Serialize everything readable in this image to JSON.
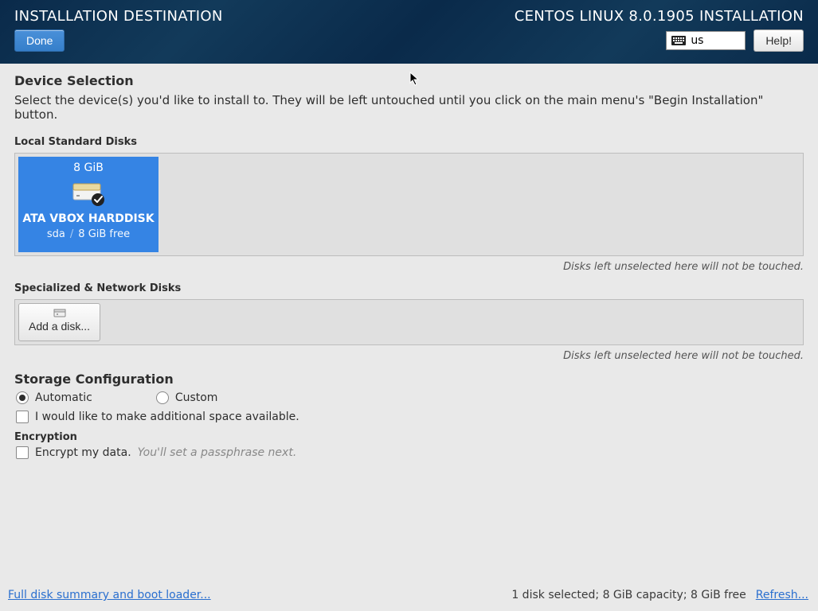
{
  "header": {
    "title": "INSTALLATION DESTINATION",
    "product": "CENTOS LINUX 8.0.1905 INSTALLATION",
    "done_label": "Done",
    "help_label": "Help!",
    "keyboard_layout": "us"
  },
  "device_selection": {
    "title": "Device Selection",
    "description": "Select the device(s) you'd like to install to.  They will be left untouched until you click on the main menu's \"Begin Installation\" button."
  },
  "local_disks": {
    "label": "Local Standard Disks",
    "hint": "Disks left unselected here will not be touched.",
    "items": [
      {
        "size": "8 GiB",
        "name": "ATA VBOX HARDDISK",
        "dev": "sda",
        "free": "8 GiB free",
        "selected": true
      }
    ]
  },
  "network_disks": {
    "label": "Specialized & Network Disks",
    "add_label": "Add a disk...",
    "hint": "Disks left unselected here will not be touched."
  },
  "storage": {
    "title": "Storage Configuration",
    "automatic_label": "Automatic",
    "custom_label": "Custom",
    "reclaim_label": "I would like to make additional space available.",
    "selected": "automatic",
    "reclaim_checked": false
  },
  "encryption": {
    "title": "Encryption",
    "encrypt_label": "Encrypt my data.",
    "hint": "You'll set a passphrase next.",
    "checked": false
  },
  "footer": {
    "summary_link": "Full disk summary and boot loader...",
    "status": "1 disk selected; 8 GiB capacity; 8 GiB free",
    "refresh_link": "Refresh..."
  }
}
